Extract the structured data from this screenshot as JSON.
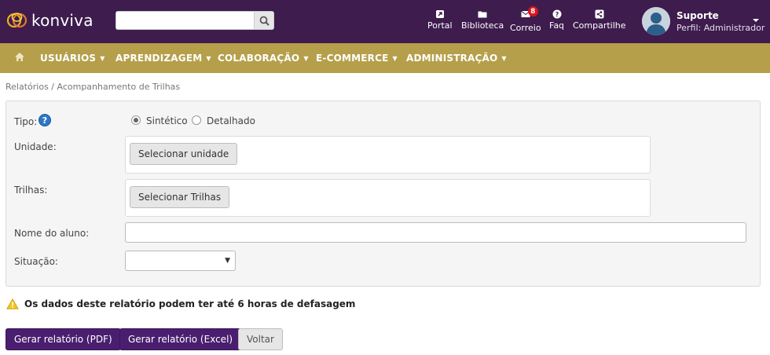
{
  "brand": {
    "name": "konviva"
  },
  "search": {
    "placeholder": "",
    "icon": "search-icon"
  },
  "toplinks": [
    {
      "label": "Portal",
      "icon": "external-link-icon"
    },
    {
      "label": "Biblioteca",
      "icon": "folder-icon"
    },
    {
      "label": "Correio",
      "icon": "envelope-icon",
      "badge": "8"
    },
    {
      "label": "Faq",
      "icon": "question-icon"
    },
    {
      "label": "Compartilhe",
      "icon": "share-icon"
    }
  ],
  "user": {
    "name": "Suporte",
    "role": "Perfil: Administrador"
  },
  "nav": {
    "items": [
      {
        "label": "USUÁRIOS"
      },
      {
        "label": "APRENDIZAGEM"
      },
      {
        "label": "COLABORAÇÃO"
      },
      {
        "label": "E-COMMERCE"
      },
      {
        "label": "ADMINISTRAÇÃO"
      }
    ]
  },
  "breadcrumb": "Relatórios / Acompanhamento de Trilhas",
  "form": {
    "tipo_label": "Tipo:",
    "tipo_options": [
      {
        "label": "Sintético",
        "checked": true
      },
      {
        "label": "Detalhado",
        "checked": false
      }
    ],
    "unidade_label": "Unidade:",
    "unidade_button": "Selecionar unidade",
    "trilhas_label": "Trilhas:",
    "trilhas_button": "Selecionar Trilhas",
    "nome_label": "Nome do aluno:",
    "nome_value": "",
    "situacao_label": "Situação:",
    "situacao_value": ""
  },
  "warning": "Os dados deste relatório podem ter até 6 horas de defasagem",
  "buttons": {
    "pdf": "Gerar relatório (PDF)",
    "excel": "Gerar relatório (Excel)",
    "back": "Voltar"
  },
  "colors": {
    "header": "#3e1c4e",
    "navbar": "#b59f4a",
    "primary_button": "#4a1e6f",
    "badge": "#d9161d",
    "help": "#2b78c5"
  }
}
